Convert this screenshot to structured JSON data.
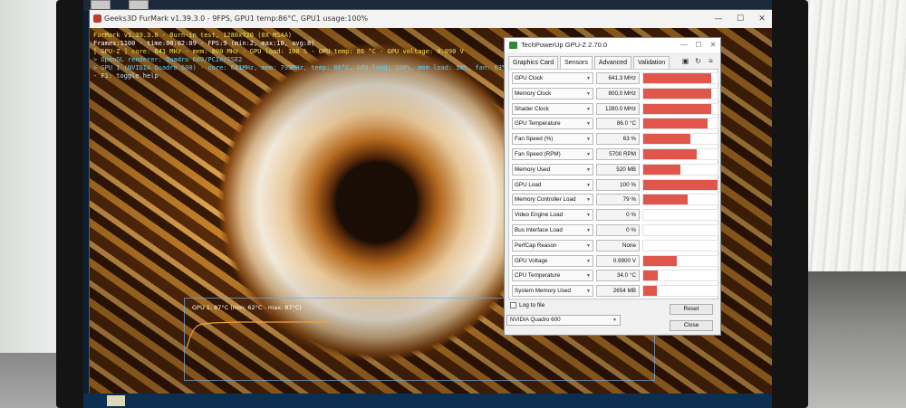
{
  "furmark": {
    "window_title": "Geeks3D FurMark v1.39.3.0 - 9FPS, GPU1 temp:86°C, GPU1 usage:100%",
    "osd": {
      "line1": "FurMark v1.39.3.0 - Burn-in test, 1280x720 (0X MSAA)",
      "line2": "Frames:1100 - time:00:02:09 - FPS:9 (min:2, max:10, avg:8)",
      "line3": "[ GPU-Z ] core: 641 MHz - mem: 800 MHz - GPU load: 100 % - GPU temp: 86 °C - GPU voltage: 0.990 V",
      "line4": "> OpenGL renderer: Quadro 600/PCIe/SSE2",
      "line5": "> GPU 1 (NVIDIA Quadro 600) - core: 641MHz, mem: 793MHz, temp: 86°C, GPU load: 100%, mem load: 58%, fan: 63%",
      "line6": "- F1: toggle help"
    },
    "graph_label": "GPU 1: 87°C (min: 62°C - max: 87°C)",
    "window_controls": {
      "minimize": "—",
      "maximize": "☐",
      "close": "✕"
    }
  },
  "gpuz": {
    "title": "TechPowerUp GPU-Z 2.70.0",
    "window_controls": {
      "minimize": "—",
      "maximize": "☐",
      "close": "✕"
    },
    "tabs": [
      "Graphics Card",
      "Sensors",
      "Advanced",
      "Validation"
    ],
    "active_tab": "Sensors",
    "toolbar_icons": [
      "camera-icon",
      "refresh-icon",
      "menu-icon"
    ],
    "sensors": [
      {
        "name": "GPU Clock",
        "value": "641.3 MHz",
        "fill": 0.92
      },
      {
        "name": "Memory Clock",
        "value": "800.0 MHz",
        "fill": 0.92
      },
      {
        "name": "Shader Clock",
        "value": "1280.0 MHz",
        "fill": 0.92
      },
      {
        "name": "GPU Temperature",
        "value": "86.0 °C",
        "fill": 0.86
      },
      {
        "name": "Fan Speed (%)",
        "value": "63 %",
        "fill": 0.63
      },
      {
        "name": "Fan Speed (RPM)",
        "value": "5700 RPM",
        "fill": 0.72
      },
      {
        "name": "Memory Used",
        "value": "520 MB",
        "fill": 0.5
      },
      {
        "name": "GPU Load",
        "value": "100 %",
        "fill": 1.0
      },
      {
        "name": "Memory Controller Load",
        "value": "79 %",
        "fill": 0.6
      },
      {
        "name": "Video Engine Load",
        "value": "0 %",
        "fill": 0.0
      },
      {
        "name": "Bus Interface Load",
        "value": "0 %",
        "fill": 0.0
      },
      {
        "name": "PerfCap Reason",
        "value": "None",
        "fill": 0.0
      },
      {
        "name": "GPU Voltage",
        "value": "0.9900 V",
        "fill": 0.45
      },
      {
        "name": "CPU Temperature",
        "value": "34.0 °C",
        "fill": 0.2
      },
      {
        "name": "System Memory Used",
        "value": "2654 MB",
        "fill": 0.18
      }
    ],
    "log_to_file": "Log to file",
    "reset": "Reset",
    "selected_gpu": "NVIDIA Quadro 600",
    "close": "Close",
    "accent_color": "#e0564a"
  }
}
